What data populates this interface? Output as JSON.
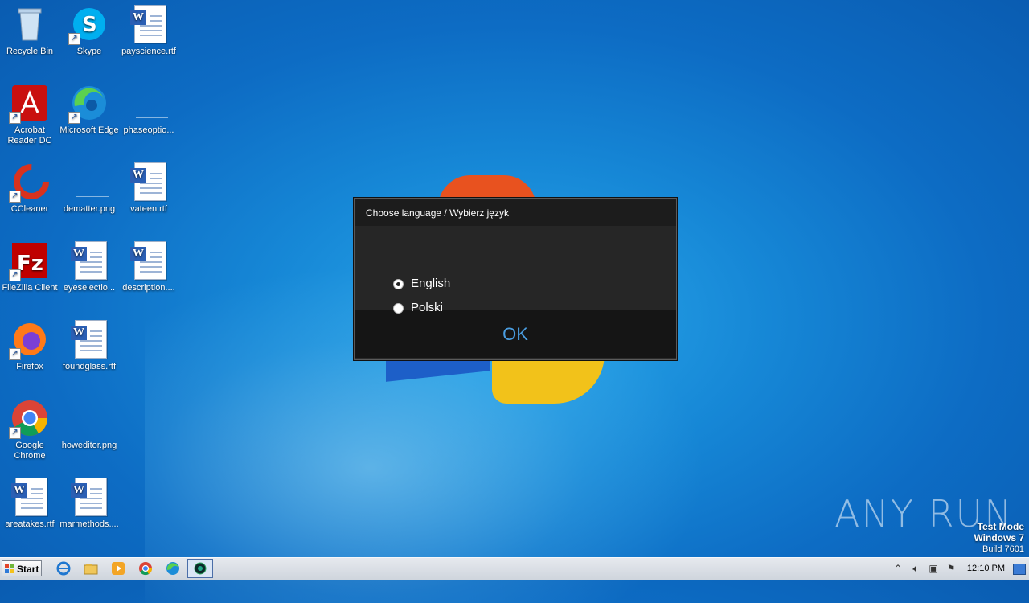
{
  "desktop": {
    "icons": [
      {
        "label": "Recycle Bin",
        "icon": "recycle-bin-icon"
      },
      {
        "label": "Skype",
        "icon": "skype-icon"
      },
      {
        "label": "payscience.rtf",
        "icon": "word-document-icon"
      },
      {
        "label": "Acrobat Reader DC",
        "icon": "acrobat-icon"
      },
      {
        "label": "Microsoft Edge",
        "icon": "edge-icon"
      },
      {
        "label": "phaseoptio...",
        "icon": "image-file-icon"
      },
      {
        "label": "CCleaner",
        "icon": "ccleaner-icon"
      },
      {
        "label": "dematter.png",
        "icon": "image-file-icon"
      },
      {
        "label": "vateen.rtf",
        "icon": "word-document-icon"
      },
      {
        "label": "FileZilla Client",
        "icon": "filezilla-icon"
      },
      {
        "label": "eyeselectio...",
        "icon": "word-document-icon"
      },
      {
        "label": "description....",
        "icon": "word-document-icon"
      },
      {
        "label": "Firefox",
        "icon": "firefox-icon"
      },
      {
        "label": "foundglass.rtf",
        "icon": "word-document-icon"
      },
      {
        "label": "Google Chrome",
        "icon": "chrome-icon"
      },
      {
        "label": "howeditor.png",
        "icon": "image-file-icon"
      },
      {
        "label": "areatakes.rtf",
        "icon": "word-document-icon"
      },
      {
        "label": "marmethods....",
        "icon": "word-document-icon"
      }
    ]
  },
  "dialog": {
    "title": "Choose language / Wybierz język",
    "options": [
      {
        "label": "English",
        "selected": true
      },
      {
        "label": "Polski",
        "selected": false
      }
    ],
    "ok_label": "OK"
  },
  "watermark": {
    "brand": "ANY RUN",
    "mode": "Test Mode",
    "os": "Windows 7",
    "build": "Build 7601"
  },
  "taskbar": {
    "start_label": "Start",
    "clock": "12:10 PM"
  },
  "colors": {
    "accent_ok": "#4a9de0",
    "dialog_bg": "#262626"
  }
}
